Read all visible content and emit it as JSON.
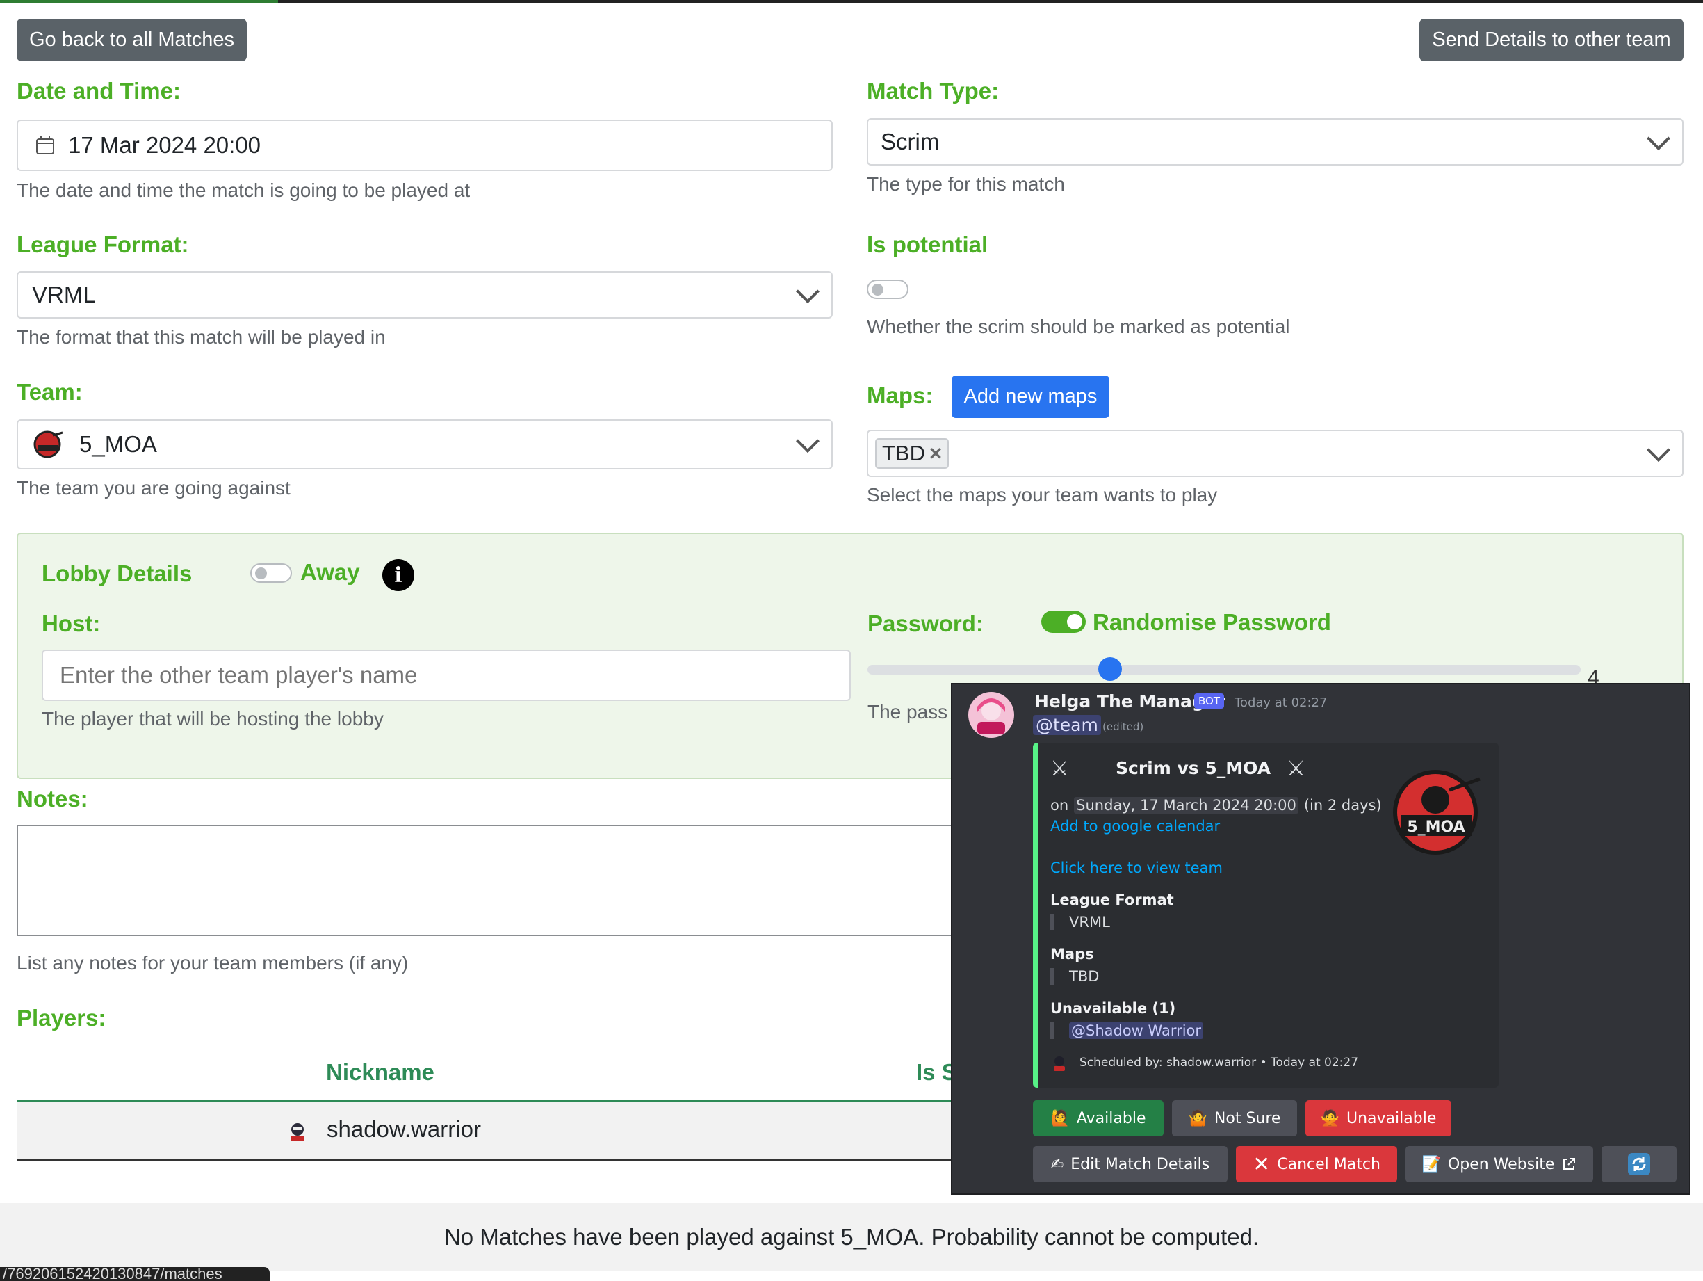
{
  "header": {
    "back_label": "Go back to all Matches",
    "send_label": "Send Details to other team"
  },
  "date_time": {
    "label": "Date and Time:",
    "value": "17 Mar 2024 20:00",
    "help": "The date and time the match is going to be played at"
  },
  "match_type": {
    "label": "Match Type:",
    "value": "Scrim",
    "help": "The type for this match"
  },
  "league_format": {
    "label": "League Format:",
    "value": "VRML",
    "help": "The format that this match will be played in"
  },
  "is_potential": {
    "label": "Is potential",
    "help": "Whether the scrim should be marked as potential"
  },
  "team": {
    "label": "Team:",
    "value": "5_MOA",
    "help": "The team you are going against"
  },
  "maps": {
    "label": "Maps:",
    "add_label": "Add new maps",
    "tag": "TBD",
    "tag_remove": "×",
    "help": "Select the maps your team wants to play"
  },
  "lobby": {
    "title": "Lobby Details",
    "away_label": "Away",
    "info_glyph": "i",
    "host_label": "Host:",
    "host_placeholder": "Enter the other team player's name",
    "host_help": "The player that will be hosting the lobby",
    "password_label": "Password:",
    "randomise_label": "Randomise Password",
    "slider_value": "4",
    "slider_fraction": 0.34,
    "password_help": "The pass"
  },
  "notes": {
    "label": "Notes:",
    "help": "List any notes for your team members (if any)"
  },
  "players": {
    "label": "Players:",
    "col_nickname": "Nickname",
    "col_is": "Is S",
    "rows": [
      {
        "nickname": "shadow.warrior"
      }
    ]
  },
  "footer": {
    "probability": "No Matches have been played against 5_MOA. Probability cannot be computed.",
    "url_fragment": "/769206152420130847/matches"
  },
  "discord": {
    "author": "Helga The Manager",
    "bot_tag": "BOT",
    "time": "Today at 02:27",
    "mention": "@team",
    "edited": "(edited)",
    "swords": "⚔",
    "embed_title": "Scrim vs 5_MOA",
    "date_prefix": "on",
    "date": "Sunday, 17 March 2024 20:00",
    "relative": "(in 2 days)",
    "calendar_link": "Add to google calendar",
    "team_link": "Click here to view team",
    "league_label": "League Format",
    "league_value": "VRML",
    "maps_label": "Maps",
    "maps_value": "TBD",
    "unavailable_label": "Unavailable (1)",
    "unavailable_user": "@Shadow Warrior",
    "footer": "Scheduled by: shadow.warrior • Today at 02:27",
    "logo_text": "5_MOA",
    "buttons": {
      "available": "Available",
      "not_sure": "Not Sure",
      "unavailable": "Unavailable",
      "edit": "Edit Match Details",
      "cancel": "Cancel Match",
      "website": "Open Website"
    },
    "colors": {
      "embed_accent": "#57f287",
      "link": "#00a8fc",
      "green_button": "#248046",
      "red_button": "#da373c",
      "gray_button": "#4e5058",
      "bot_badge": "#5865f2"
    }
  },
  "colors": {
    "label_green": "#4caf26",
    "table_header": "#2e8b57",
    "primary_blue": "#2874f0",
    "dark_button": "#5a6268"
  }
}
